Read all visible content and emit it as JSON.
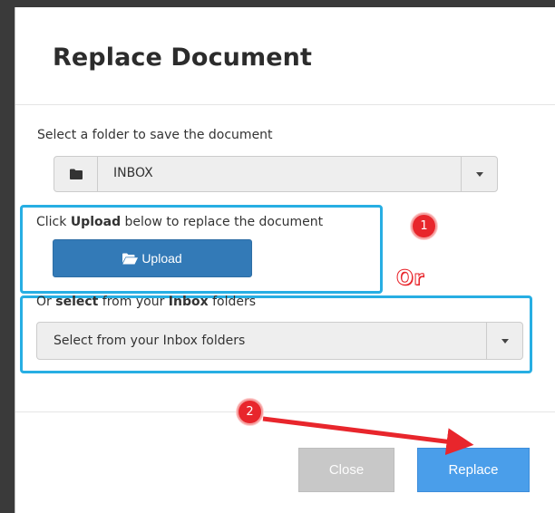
{
  "dialog": {
    "title": "Replace Document"
  },
  "folder": {
    "label": "Select a folder to save the document",
    "value": "INBOX",
    "icon": "folder-icon"
  },
  "upload": {
    "text_prefix": "Click ",
    "text_bold": "Upload",
    "text_suffix": " below to replace the document",
    "button_label": "Upload",
    "button_icon": "folder-open-icon"
  },
  "inbox": {
    "text_prefix": "Or ",
    "text_bold_1": "select",
    "text_middle": " from your ",
    "text_bold_2": "Inbox",
    "text_suffix": " folders",
    "select_value": "Select from your Inbox folders"
  },
  "annotations": {
    "step_one": "1",
    "step_two": "2",
    "or_label": "Or",
    "highlight_color": "#27aee3",
    "badge_color": "#e8262c"
  },
  "footer": {
    "close_label": "Close",
    "replace_label": "Replace"
  },
  "colors": {
    "primary": "#337ab7",
    "replace": "#4a9eea",
    "close_disabled": "#c8c8c8"
  }
}
